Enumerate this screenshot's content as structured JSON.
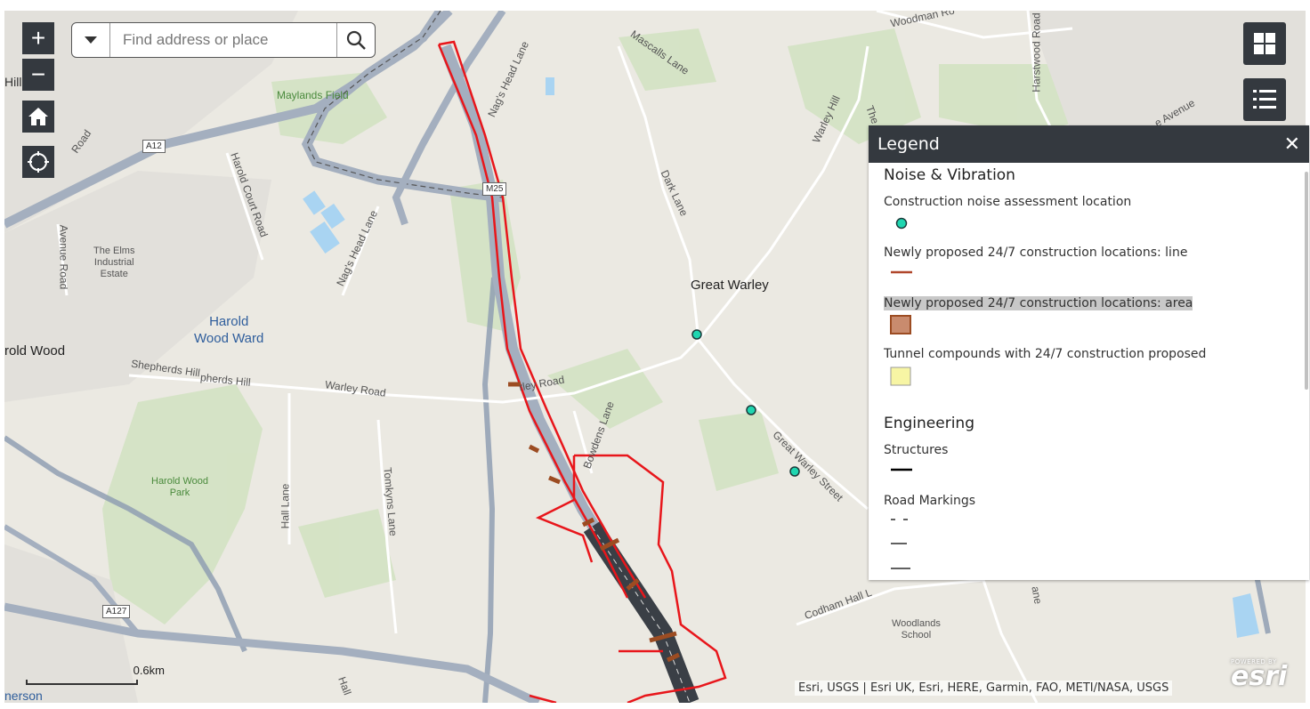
{
  "search": {
    "placeholder": "Find address or place"
  },
  "zoom": {
    "in_label": "+",
    "out_label": "−"
  },
  "map_labels": {
    "maylands_field": "Maylands Field",
    "mascalls_lane": "Mascalls Lane",
    "woodman_road": "Woodman Ro",
    "harstwood_road": "Harstwood Road",
    "warley_hill": "Warley Hill",
    "nags_head_lane_top": "Nag's Head Lane",
    "nags_head_lane_mid": "Nag's Head Lane",
    "harold_court_road": "Harold Court Road",
    "avenue_road": "Avenue Road",
    "the_elms": "The Elms\nIndustrial\nEstate",
    "harold_wood_ward": "Harold\nWood Ward",
    "harold_wood": "rold Wood",
    "hill": "Hill",
    "shepherds_hill_1": "Shepherds Hill",
    "shepherds_hill_2": "pherds Hill",
    "warley_road_1": "Warley Road",
    "warley_road_2": "rley Road",
    "dark_lane": "Dark Lane",
    "great_warley": "Great Warley",
    "great_warley_street": "Great Warley Street",
    "bowdens_lane": "Bowdens Lane",
    "harold_wood_park": "Harold Wood\nPark",
    "hall_lane": "Hall Lane",
    "tomkyns_lane": "Tomkyns Lane",
    "codham_hall": "Codham Hall L",
    "woodlands_school": "Woodlands\nSchool",
    "road_a": "Road",
    "the": "The",
    "avenue": "e Avenue",
    "hall_bottom": "Hall",
    "nerson": "nerson",
    "lane_right": "ane"
  },
  "road_shields": {
    "a12": "A12",
    "m25": "M25",
    "a127": "A127"
  },
  "legend": {
    "title": "Legend",
    "close_label": "✕",
    "groups": [
      {
        "title": "Noise & Vibration",
        "items": [
          {
            "label": "Construction noise assessment location",
            "swatch": "circle",
            "color": "#1fd6b0"
          },
          {
            "label": "Newly proposed 24/7 construction locations: line",
            "swatch": "line",
            "color": "#b0462a"
          },
          {
            "label": "Newly proposed 24/7 construction locations: area",
            "swatch": "area",
            "color": "#c98b6e"
          },
          {
            "label": "Tunnel compounds with 24/7 construction proposed",
            "swatch": "area-yellow",
            "color": "#f7f5a4"
          }
        ]
      },
      {
        "title": "Engineering",
        "items": [
          {
            "label": "Structures",
            "swatch": "solid-black",
            "color": "#000000"
          },
          {
            "label": "Road Markings",
            "swatch": "dashed",
            "color": "#000000"
          }
        ]
      }
    ]
  },
  "scale": {
    "label": "0.6km"
  },
  "attribution": "Esri, USGS | Esri UK, Esri, HERE, Garmin, FAO, METI/NASA, USGS",
  "esri_logo": {
    "powered_by": "POWERED BY",
    "name": "esri"
  },
  "colors": {
    "widget_bg": "#34393f",
    "route_red": "#e8161b",
    "noise_point": "#1fd6b0",
    "motorway": "#9aa6b8"
  }
}
